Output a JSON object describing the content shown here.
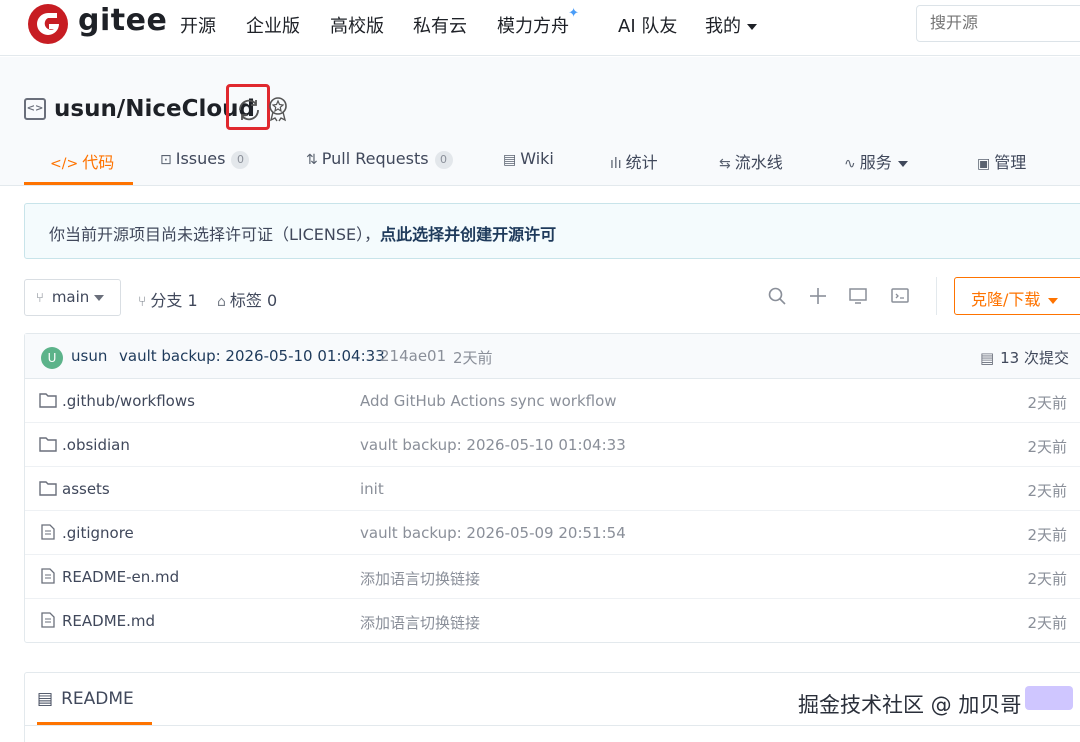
{
  "nav": {
    "brand": "gitee",
    "items": [
      "开源",
      "企业版",
      "高校版",
      "私有云",
      "模力方舟",
      "AI 队友",
      "我的"
    ],
    "spark": "✦",
    "search_placeholder": "搜开源"
  },
  "repo": {
    "title": "usun/NiceCloud",
    "tabs": [
      {
        "label": "代码",
        "icon": "</>",
        "active": true
      },
      {
        "label": "Issues",
        "icon": "⊡",
        "count": "0"
      },
      {
        "label": "Pull Requests",
        "icon": "⇅",
        "count": "0"
      },
      {
        "label": "Wiki",
        "icon": "▤"
      },
      {
        "label": "统计",
        "icon": "ılı"
      },
      {
        "label": "流水线",
        "icon": "⇆"
      },
      {
        "label": "服务",
        "icon": "∿"
      },
      {
        "label": "管理",
        "icon": "▣"
      }
    ]
  },
  "notice": {
    "text": "你当前开源项目尚未选择许可证（LICENSE），",
    "link": "点此选择并创建开源许可"
  },
  "toolbar": {
    "branch": "main",
    "branches": "分支 1",
    "tags": "标签 0",
    "clone": "克隆/下载"
  },
  "commit": {
    "avatar": "U",
    "user": "usun",
    "message": "vault backup: 2026-05-10 01:04:33",
    "hash": "214ae01",
    "time": "2天前",
    "count": "13 次提交"
  },
  "files": [
    {
      "type": "folder",
      "name": ".github/workflows",
      "msg": "Add GitHub Actions sync workflow",
      "time": "2天前"
    },
    {
      "type": "folder",
      "name": ".obsidian",
      "msg": "vault backup: 2026-05-10 01:04:33",
      "time": "2天前"
    },
    {
      "type": "folder",
      "name": "assets",
      "msg": "init",
      "time": "2天前"
    },
    {
      "type": "file",
      "name": ".gitignore",
      "msg": "vault backup: 2026-05-09 20:51:54",
      "time": "2天前"
    },
    {
      "type": "file",
      "name": "README-en.md",
      "msg": "添加语言切换链接",
      "time": "2天前"
    },
    {
      "type": "file",
      "name": "README.md",
      "msg": "添加语言切换链接",
      "time": "2天前"
    }
  ],
  "readme": {
    "icon": "▤",
    "label": "README"
  },
  "watermark": "掘金技术社区 @ 加贝哥",
  "colors": {
    "accent": "#fe7300",
    "brand_red": "#c71d23",
    "highlight_box": "#e0282e"
  }
}
